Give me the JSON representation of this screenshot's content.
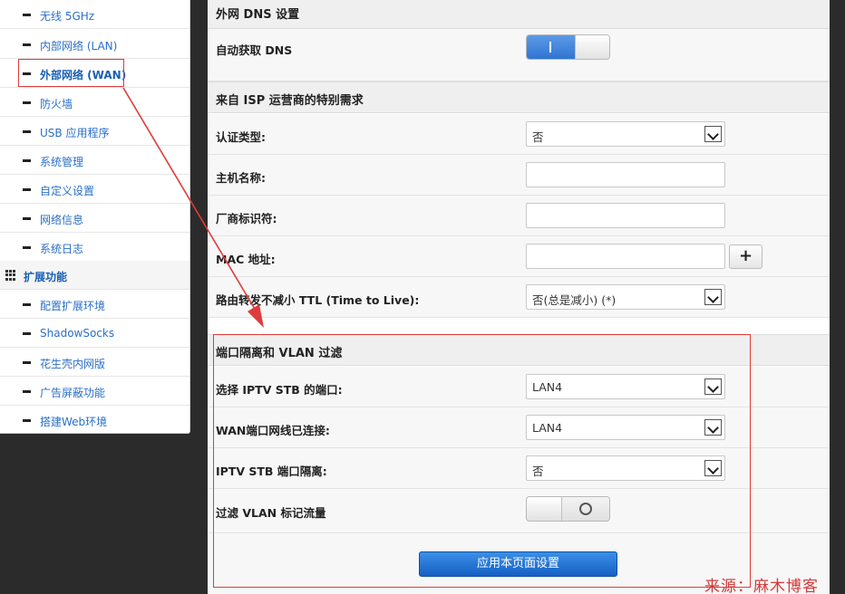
{
  "sidebar": {
    "items": [
      {
        "label": "无线 5GHz"
      },
      {
        "label": "内部网络 (LAN)"
      },
      {
        "label": "外部网络 (WAN)"
      },
      {
        "label": "防火墙"
      },
      {
        "label": "USB 应用程序"
      },
      {
        "label": "系统管理"
      },
      {
        "label": "自定义设置"
      },
      {
        "label": "网络信息"
      },
      {
        "label": "系统日志"
      }
    ],
    "active_item": "外部网络 (WAN)",
    "section": {
      "label": "扩展功能"
    },
    "ext_items": [
      {
        "label": "配置扩展环境"
      },
      {
        "label": "ShadowSocks"
      },
      {
        "label": "花生壳内网版"
      },
      {
        "label": "广告屏蔽功能"
      },
      {
        "label": "搭建Web环境"
      }
    ]
  },
  "main": {
    "dns_section": {
      "title": "外网 DNS 设置",
      "auto_dns": {
        "label": "自动获取 DNS",
        "state": "on"
      }
    },
    "isp_section": {
      "title": "来自 ISP 运营商的特别需求",
      "auth_type": {
        "label": "认证类型:",
        "value": "否"
      },
      "hostname": {
        "label": "主机名称:",
        "value": ""
      },
      "vendor_id": {
        "label": "厂商标识符:",
        "value": ""
      },
      "mac": {
        "label": "MAC 地址:",
        "value": "",
        "add_button": "+"
      },
      "ttl": {
        "label": "路由转发不减小 TTL (Time to Live):",
        "value": "否(总是减小) (*)"
      }
    },
    "vlan_section": {
      "title": "端口隔离和 VLAN 过滤",
      "iptv_port": {
        "label": "选择 IPTV STB 的端口:",
        "value": "LAN4"
      },
      "wan_connected": {
        "label": "WAN端口网线已连接:",
        "value": "LAN4"
      },
      "iptv_isolation": {
        "label": "IPTV STB 端口隔离:",
        "value": "否"
      },
      "vlan_filter": {
        "label": "过滤 VLAN 标记流量",
        "state": "off"
      }
    },
    "apply_button": "应用本页面设置"
  },
  "watermark": "来源：麻木博客",
  "colors": {
    "link": "#2a6fc9",
    "highlight": "#e03b3b",
    "primary_button": "#1f6fd0",
    "toggle_on": "#2f75d3"
  }
}
